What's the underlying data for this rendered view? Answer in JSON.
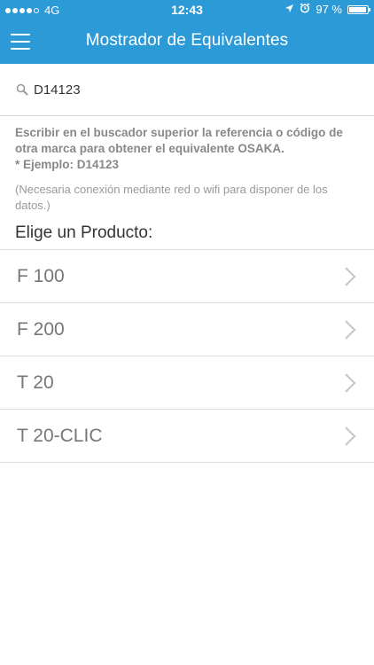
{
  "status_bar": {
    "network": "4G",
    "time": "12:43",
    "battery_text": "97 %",
    "battery_level": 0.97
  },
  "nav": {
    "title": "Mostrador de Equivalentes",
    "menu_icon": "hamburger-menu-icon"
  },
  "search": {
    "value": "D14123",
    "icon": "search-icon"
  },
  "info": {
    "main": "Escribir en el buscador superior la referencia o código de otra marca para obtener el equivalente OSAKA.",
    "example": "* Ejemplo: D14123",
    "note": "(Necesaria conexión mediante red o wifi para disponer de los datos.)"
  },
  "list": {
    "heading": "Elige un Producto:",
    "items": [
      {
        "label": "F 100"
      },
      {
        "label": "F 200"
      },
      {
        "label": "T 20"
      },
      {
        "label": "T 20-CLIC"
      }
    ]
  },
  "colors": {
    "header_blue": "#2b9ad7"
  }
}
